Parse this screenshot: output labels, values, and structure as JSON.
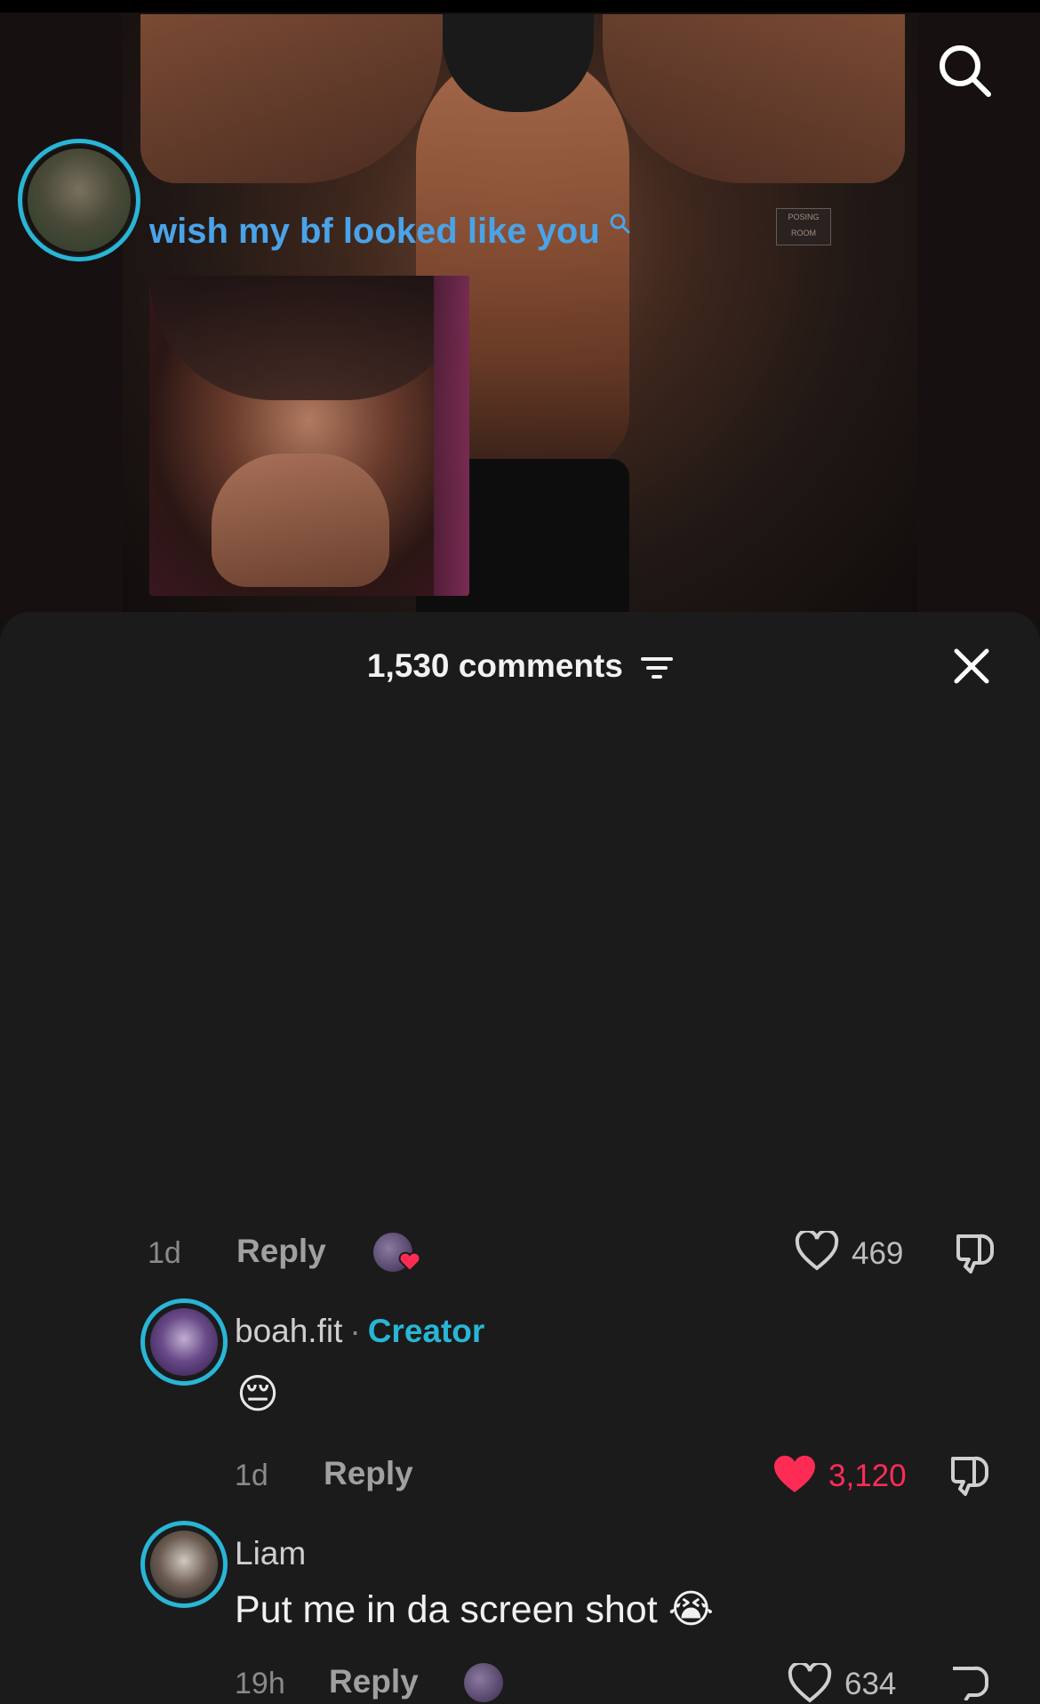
{
  "video": {
    "sign_text": "POSING ROOM"
  },
  "comments_header": {
    "title": "1,530 comments"
  },
  "comments": [
    {
      "text": "wish my bf looked like you",
      "has_gif": true,
      "time": "1d",
      "reply_label": "Reply",
      "likes": "469",
      "liked": false
    },
    {
      "username": "boah.fit",
      "separator": "·",
      "badge": "Creator",
      "emoji": "😔",
      "time": "1d",
      "reply_label": "Reply",
      "likes": "3,120",
      "liked": true
    },
    {
      "username": "Liam",
      "text": "Put me in da screen shot",
      "emoji": "😭",
      "time": "19h",
      "reply_label": "Reply",
      "likes": "634",
      "liked": false
    }
  ],
  "colors": {
    "accent_link": "#4aa3e8",
    "creator_badge": "#29b5d6",
    "liked_heart": "#fe2c55",
    "sheet_bg": "#1b1b1b"
  }
}
